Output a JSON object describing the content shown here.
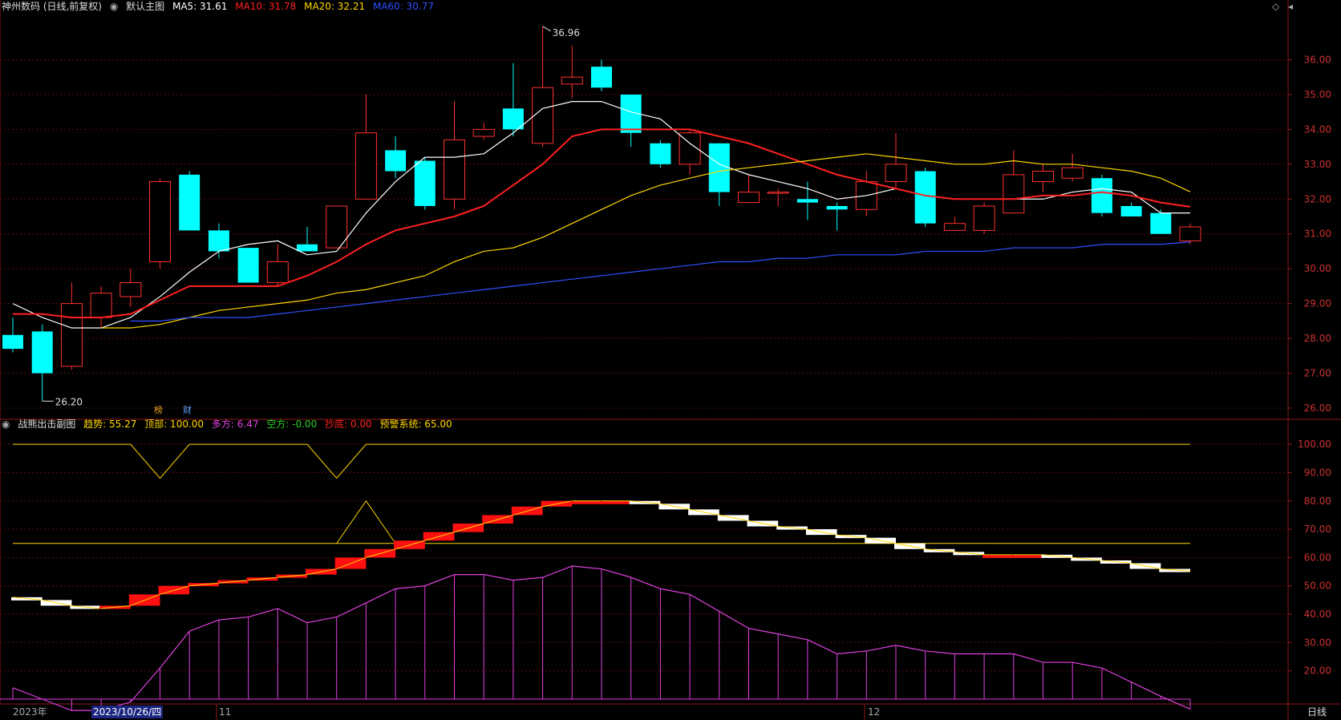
{
  "main_header": {
    "title": "神州数码 (日线,前复权)",
    "sub": "默认主图",
    "items": [
      {
        "label": "MA5: 31.61",
        "color": "#ffffff"
      },
      {
        "label": "MA10: 31.78",
        "color": "#ff2020"
      },
      {
        "label": "MA20: 32.21",
        "color": "#ffd700"
      },
      {
        "label": "MA60: 30.77",
        "color": "#3050ff"
      }
    ]
  },
  "sub_header": {
    "title": "战熊出击副图",
    "items": [
      {
        "label": "趋势: 55.27",
        "color": "#ffd700"
      },
      {
        "label": "顶部: 100.00",
        "color": "#ffd700"
      },
      {
        "label": "多方: 6.47",
        "color": "#e040e0"
      },
      {
        "label": "空方: -0.00",
        "color": "#20d020"
      },
      {
        "label": "抄底: 0.00",
        "color": "#ff2020"
      },
      {
        "label": "预警系统: 65.00",
        "color": "#ffd700"
      }
    ]
  },
  "markers": {
    "m1": "榜",
    "m2": "财"
  },
  "bottom_bar": {
    "year": "2023年",
    "cursor_date": "2023/10/26/四",
    "m11": "11",
    "m12": "12",
    "period": "日线"
  },
  "chart_data": [
    {
      "type": "candlestick",
      "title": "神州数码 (日线,前复权)",
      "ylim": [
        25.7,
        37.3
      ],
      "y_ticks": [
        "36.00",
        "35.00",
        "34.00",
        "33.00",
        "32.00",
        "31.00",
        "30.00",
        "29.00",
        "28.00",
        "27.00",
        "26.00"
      ],
      "y_tick_values": [
        36,
        35,
        34,
        33,
        32,
        31,
        30,
        29,
        28,
        27,
        26
      ],
      "max_label": "36.96",
      "min_label": "26.20",
      "candles": [
        {
          "o": 28.1,
          "h": 28.6,
          "l": 27.6,
          "c": 27.7
        },
        {
          "o": 28.2,
          "h": 28.4,
          "l": 26.2,
          "c": 27.0
        },
        {
          "o": 27.2,
          "h": 29.6,
          "l": 27.1,
          "c": 29.0
        },
        {
          "o": 28.6,
          "h": 29.5,
          "l": 28.3,
          "c": 29.3
        },
        {
          "o": 29.2,
          "h": 30.0,
          "l": 28.9,
          "c": 29.6
        },
        {
          "o": 30.2,
          "h": 32.6,
          "l": 30.0,
          "c": 32.5
        },
        {
          "o": 32.7,
          "h": 32.8,
          "l": 31.1,
          "c": 31.1
        },
        {
          "o": 31.1,
          "h": 31.3,
          "l": 30.3,
          "c": 30.5
        },
        {
          "o": 30.6,
          "h": 30.6,
          "l": 29.6,
          "c": 29.6
        },
        {
          "o": 29.6,
          "h": 30.7,
          "l": 29.5,
          "c": 30.2
        },
        {
          "o": 30.7,
          "h": 31.2,
          "l": 30.5,
          "c": 30.5
        },
        {
          "o": 30.6,
          "h": 31.8,
          "l": 30.6,
          "c": 31.8
        },
        {
          "o": 32.0,
          "h": 35.0,
          "l": 32.0,
          "c": 33.9
        },
        {
          "o": 33.4,
          "h": 33.8,
          "l": 32.6,
          "c": 32.8
        },
        {
          "o": 33.1,
          "h": 33.2,
          "l": 31.7,
          "c": 31.8
        },
        {
          "o": 32.0,
          "h": 34.8,
          "l": 31.7,
          "c": 33.7
        },
        {
          "o": 33.8,
          "h": 34.2,
          "l": 33.7,
          "c": 34.0
        },
        {
          "o": 34.6,
          "h": 35.9,
          "l": 33.8,
          "c": 34.0
        },
        {
          "o": 33.6,
          "h": 36.96,
          "l": 33.5,
          "c": 35.2
        },
        {
          "o": 35.3,
          "h": 36.4,
          "l": 34.9,
          "c": 35.5
        },
        {
          "o": 35.8,
          "h": 36.0,
          "l": 35.1,
          "c": 35.2
        },
        {
          "o": 35.0,
          "h": 35.0,
          "l": 33.5,
          "c": 33.9
        },
        {
          "o": 33.6,
          "h": 33.7,
          "l": 32.9,
          "c": 33.0
        },
        {
          "o": 33.0,
          "h": 34.0,
          "l": 32.7,
          "c": 33.9
        },
        {
          "o": 33.6,
          "h": 33.6,
          "l": 31.8,
          "c": 32.2
        },
        {
          "o": 31.9,
          "h": 32.7,
          "l": 31.9,
          "c": 32.2
        },
        {
          "o": 32.2,
          "h": 32.3,
          "l": 31.8,
          "c": 32.2
        },
        {
          "o": 32.0,
          "h": 32.5,
          "l": 31.4,
          "c": 31.9
        },
        {
          "o": 31.8,
          "h": 31.9,
          "l": 31.1,
          "c": 31.7
        },
        {
          "o": 31.7,
          "h": 32.8,
          "l": 31.5,
          "c": 32.5
        },
        {
          "o": 32.5,
          "h": 33.9,
          "l": 32.3,
          "c": 33.0
        },
        {
          "o": 32.8,
          "h": 32.9,
          "l": 31.2,
          "c": 31.3
        },
        {
          "o": 31.1,
          "h": 31.5,
          "l": 31.1,
          "c": 31.3
        },
        {
          "o": 31.1,
          "h": 31.9,
          "l": 31.0,
          "c": 31.8
        },
        {
          "o": 31.6,
          "h": 33.4,
          "l": 31.6,
          "c": 32.7
        },
        {
          "o": 32.5,
          "h": 33.0,
          "l": 32.2,
          "c": 32.8
        },
        {
          "o": 32.6,
          "h": 33.3,
          "l": 32.5,
          "c": 32.9
        },
        {
          "o": 32.6,
          "h": 32.7,
          "l": 31.5,
          "c": 31.6
        },
        {
          "o": 31.8,
          "h": 31.9,
          "l": 31.5,
          "c": 31.5
        },
        {
          "o": 31.6,
          "h": 31.7,
          "l": 31.0,
          "c": 31.0
        },
        {
          "o": 30.8,
          "h": 31.3,
          "l": 30.7,
          "c": 31.2
        }
      ],
      "series": [
        {
          "name": "MA5",
          "color": "#ffffff",
          "values": [
            29.0,
            28.6,
            28.3,
            28.3,
            28.6,
            29.2,
            29.9,
            30.5,
            30.7,
            30.8,
            30.4,
            30.5,
            31.6,
            32.5,
            33.2,
            33.2,
            33.3,
            33.9,
            34.6,
            34.8,
            34.8,
            34.5,
            34.3,
            33.6,
            33.0,
            32.7,
            32.5,
            32.3,
            32.0,
            32.1,
            32.3,
            32.1,
            32.0,
            32.0,
            32.0,
            32.0,
            32.2,
            32.3,
            32.2,
            31.6,
            31.6
          ]
        },
        {
          "name": "MA10",
          "color": "#ff2020",
          "values": [
            28.7,
            28.7,
            28.6,
            28.6,
            28.7,
            29.1,
            29.5,
            29.5,
            29.5,
            29.5,
            29.8,
            30.2,
            30.7,
            31.1,
            31.3,
            31.5,
            31.8,
            32.4,
            33.0,
            33.8,
            34.0,
            34.0,
            34.0,
            34.0,
            33.8,
            33.6,
            33.3,
            33.0,
            32.7,
            32.5,
            32.3,
            32.1,
            32.0,
            32.0,
            32.0,
            32.1,
            32.1,
            32.2,
            32.1,
            31.9,
            31.78
          ]
        },
        {
          "name": "MA20",
          "color": "#ffd700",
          "values": [
            28.3,
            28.3,
            28.4,
            28.6,
            28.8,
            28.9,
            29.0,
            29.1,
            29.3,
            29.4,
            29.6,
            29.8,
            30.2,
            30.5,
            30.6,
            30.9,
            31.3,
            31.7,
            32.1,
            32.4,
            32.6,
            32.8,
            32.9,
            33.0,
            33.1,
            33.2,
            33.3,
            33.2,
            33.1,
            33.0,
            33.0,
            33.1,
            33.0,
            33.0,
            32.9,
            32.8,
            32.6,
            32.21
          ]
        },
        {
          "name": "MA60",
          "color": "#3050ff",
          "values": [
            28.5,
            28.5,
            28.6,
            28.6,
            28.6,
            28.7,
            28.8,
            28.9,
            29.0,
            29.1,
            29.2,
            29.3,
            29.4,
            29.5,
            29.6,
            29.7,
            29.8,
            29.9,
            30.0,
            30.1,
            30.2,
            30.2,
            30.3,
            30.3,
            30.4,
            30.4,
            30.4,
            30.5,
            30.5,
            30.5,
            30.6,
            30.6,
            30.6,
            30.7,
            30.7,
            30.7,
            30.77
          ]
        }
      ]
    },
    {
      "type": "indicator",
      "title": "战熊出击副图",
      "ylim": [
        10,
        104
      ],
      "y_ticks": [
        "100.00",
        "90.00",
        "80.00",
        "70.00",
        "60.00",
        "50.00",
        "40.00",
        "30.00",
        "20.00"
      ],
      "y_tick_values": [
        100,
        90,
        80,
        70,
        60,
        50,
        40,
        30,
        20
      ],
      "warning_level": 65,
      "top_level": 100,
      "series": [
        {
          "name": "多方",
          "color": "#e040e0",
          "values": [
            14,
            10,
            6,
            6,
            9,
            21,
            34,
            38,
            39,
            42,
            37,
            39,
            44,
            49,
            50,
            54,
            54,
            52,
            53,
            57,
            56,
            53,
            49,
            47,
            41,
            35,
            33,
            31,
            26,
            27,
            29,
            27,
            26,
            26,
            26,
            23,
            23,
            21,
            16,
            11,
            6.47
          ]
        },
        {
          "name": "趋势",
          "type": "ribbon",
          "values": [
            46,
            45,
            43,
            42,
            43,
            47,
            50,
            51,
            52,
            53,
            54,
            56,
            60,
            63,
            66,
            69,
            72,
            75,
            78,
            80,
            80,
            80,
            79,
            77,
            75,
            73,
            71,
            70,
            68,
            67,
            65,
            63,
            62,
            61,
            61,
            61,
            60,
            59,
            58,
            56,
            55.27
          ]
        },
        {
          "name": "顶部",
          "color": "#ffd700",
          "values": [
            100,
            100,
            100,
            100,
            100,
            88,
            100,
            100,
            100,
            100,
            100,
            88,
            100,
            100,
            100,
            100,
            100,
            100,
            100,
            100,
            100,
            100,
            100,
            100,
            100,
            100,
            100,
            100,
            100,
            100,
            100,
            100,
            100,
            100,
            100,
            100,
            100,
            100,
            100,
            100,
            100
          ]
        }
      ]
    }
  ]
}
